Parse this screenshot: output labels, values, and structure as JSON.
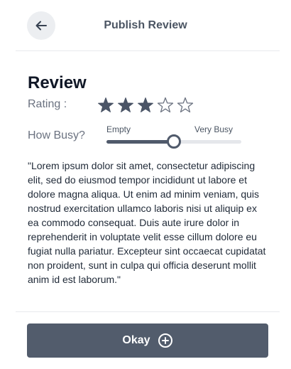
{
  "header": {
    "title": "Publish Review",
    "back_icon": "arrow-left-icon"
  },
  "review": {
    "heading": "Review",
    "rating_label": "Rating :",
    "rating": 3,
    "rating_max": 5,
    "busy_label": "How Busy?",
    "busy_min_label": "Empty",
    "busy_max_label": "Very Busy",
    "busy_level": 0.5,
    "text": "\"Lorem ipsum dolor sit amet, consectetur adipiscing elit, sed do eiusmod tempor incididunt ut labore et dolore magna aliqua. Ut enim ad minim veniam, quis nostrud exercitation ullamco laboris nisi ut aliquip ex ea commodo consequat. Duis aute irure dolor in reprehenderit in voluptate velit esse cillum dolore eu fugiat nulla pariatur. Excepteur sint occaecat cupidatat non proident, sunt in culpa qui officia deserunt mollit anim id est laborum.\""
  },
  "footer": {
    "okay_label": "Okay",
    "okay_icon": "plus-circle-icon"
  },
  "colors": {
    "accent": "#525c6c",
    "star_filled": "#4b5567",
    "star_empty_stroke": "#6b7280",
    "back_button_bg": "#eceef1"
  }
}
